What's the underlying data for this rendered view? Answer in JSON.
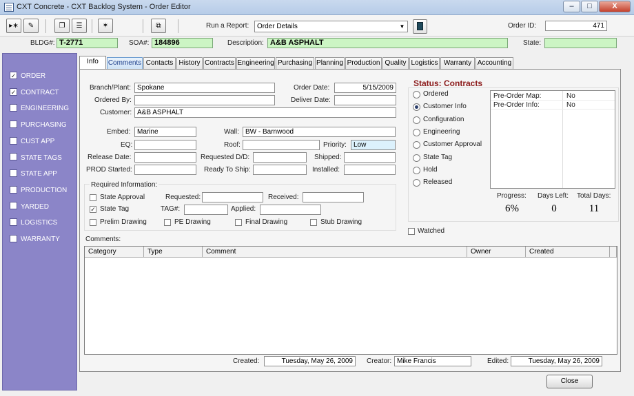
{
  "window": {
    "title": "CXT Concrete - CXT Backlog System - Order Editor",
    "min_glyph": "–",
    "max_glyph": "□",
    "close_glyph": "X"
  },
  "toolbar": {
    "btn1_glyph": "▸∗",
    "btn2_glyph": "✎",
    "btn3_glyph": "❐",
    "btn4_glyph": "☰",
    "btn5_glyph": "✶",
    "btn6_glyph": "⧉",
    "run_report_label": "Run a Report:",
    "report_value": "Order Details",
    "order_id_label": "Order ID:",
    "order_id": "471"
  },
  "header": {
    "bldg_label": "BLDG#:",
    "bldg": "T-2771",
    "soa_label": "SOA#:",
    "soa": "184896",
    "description_label": "Description:",
    "description": "A&B ASPHALT",
    "state_label": "State:",
    "state": ""
  },
  "sidebar": {
    "items": [
      {
        "label": "ORDER",
        "checked": true
      },
      {
        "label": "CONTRACT",
        "checked": true
      },
      {
        "label": "ENGINEERING",
        "checked": false
      },
      {
        "label": "PURCHASING",
        "checked": false
      },
      {
        "label": "CUST APP",
        "checked": false
      },
      {
        "label": "STATE TAGS",
        "checked": false
      },
      {
        "label": "STATE APP",
        "checked": false
      },
      {
        "label": "PRODUCTION",
        "checked": false
      },
      {
        "label": "YARDED",
        "checked": false
      },
      {
        "label": "LOGISTICS",
        "checked": false
      },
      {
        "label": "WARRANTY",
        "checked": false
      }
    ]
  },
  "tabs": [
    "Info",
    "Comments",
    "Contacts",
    "History",
    "Contracts",
    "Engineering",
    "Purchasing",
    "Planning",
    "Production",
    "Quality",
    "Logistics",
    "Warranty",
    "Accounting"
  ],
  "form": {
    "branch_label": "Branch/Plant:",
    "branch": "Spokane",
    "order_date_label": "Order Date:",
    "order_date": "5/15/2009",
    "ordered_by_label": "Ordered By:",
    "ordered_by": "",
    "deliver_date_label": "Deliver Date:",
    "deliver_date": "",
    "customer_label": "Customer:",
    "customer": "A&B ASPHALT",
    "embed_label": "Embed:",
    "embed": "Marine",
    "wall_label": "Wall:",
    "wall": "BW - Barnwood",
    "eq_label": "EQ:",
    "eq": "",
    "roof_label": "Roof:",
    "roof": "",
    "priority_label": "Priority:",
    "priority": "Low",
    "release_date_label": "Release Date:",
    "release_date": "",
    "requested_dd_label": "Requested D/D:",
    "requested_dd": "",
    "shipped_label": "Shipped:",
    "shipped": "",
    "prod_started_label": "PROD Started:",
    "prod_started": "",
    "ready_to_ship_label": "Ready To Ship:",
    "ready_to_ship": "",
    "installed_label": "Installed:",
    "installed": ""
  },
  "required": {
    "legend": "Required Information:",
    "state_approval_label": "State Approval",
    "requested_label": "Requested:",
    "requested": "",
    "received_label": "Received:",
    "received": "",
    "state_tag_label": "State Tag",
    "tag_label": "TAG#:",
    "tag": "",
    "applied_label": "Applied:",
    "applied": "",
    "prelim_label": "Prelim Drawing",
    "pe_label": "PE Drawing",
    "final_label": "Final Drawing",
    "stub_label": "Stub Drawing"
  },
  "status": {
    "title": "Status: Contracts",
    "options": [
      "Ordered",
      "Customer Info",
      "Configuration",
      "Engineering",
      "Customer Approval",
      "State Tag",
      "Hold",
      "Released"
    ],
    "selected_index": 1,
    "info_rows": [
      {
        "label": "Pre-Order Map:",
        "value": "No"
      },
      {
        "label": "Pre-Order Info:",
        "value": "No"
      }
    ],
    "progress_label": "Progress:",
    "progress": "6%",
    "days_left_label": "Days Left:",
    "days_left": "0",
    "total_days_label": "Total Days:",
    "total_days": "11",
    "watched_label": "Watched"
  },
  "comments": {
    "label": "Comments:",
    "columns": [
      "Category",
      "Type",
      "Comment",
      "Owner",
      "Created"
    ]
  },
  "footer": {
    "created_label": "Created:",
    "created": "Tuesday, May 26, 2009",
    "creator_label": "Creator:",
    "creator": "Mike Francis",
    "edited_label": "Edited:",
    "edited": "Tuesday, May 26, 2009",
    "close_label": "Close"
  },
  "colors": {
    "sidebar": "#8b85c8",
    "highlight_field": "#ccf5c4",
    "status_title": "#8b1a1a"
  }
}
